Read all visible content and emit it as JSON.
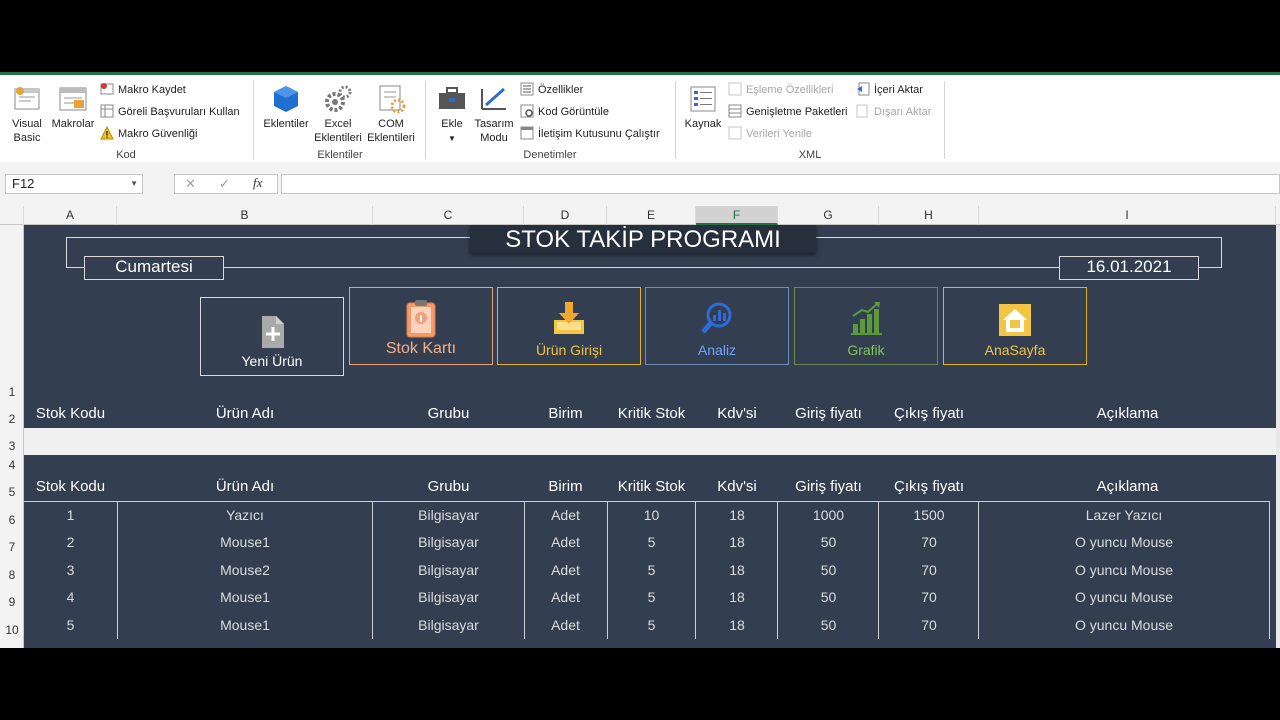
{
  "ribbon": {
    "kod": {
      "label": "Kod",
      "visual_basic": "Visual Basic",
      "makrolar": "Makrolar",
      "makro_kaydet": "Makro Kaydet",
      "goreli": "Göreli Başvuruları Kullan",
      "makro_guvenligi": "Makro Güvenliği"
    },
    "eklentiler": {
      "label": "Eklentiler",
      "eklentiler": "Eklentiler",
      "excel_eklentileri": "Excel Eklentileri",
      "com_eklentileri": "COM Eklentileri"
    },
    "denetimler": {
      "label": "Denetimler",
      "ekle": "Ekle",
      "tasarim": "Tasarım Modu",
      "ozellikler": "Özellikler",
      "kod_goruntule": "Kod Görüntüle",
      "iletisim": "İletişim Kutusunu Çalıştır"
    },
    "xml": {
      "label": "XML",
      "kaynak": "Kaynak",
      "esleme": "Eşleme Özellikleri",
      "genisletme": "Genişletme Paketleri",
      "verileri_yenile": "Verileri Yenile",
      "iceri_aktar": "İçeri Aktar",
      "disari_aktar": "Dışarı Aktar"
    }
  },
  "formula_bar": {
    "name_box": "F12",
    "cancel": "✕",
    "enter": "✓",
    "fx": "fx",
    "formula": ""
  },
  "columns": [
    "A",
    "B",
    "C",
    "D",
    "E",
    "F",
    "G",
    "H",
    "I"
  ],
  "rows": [
    "1",
    "2",
    "3",
    "4",
    "5",
    "6",
    "7",
    "8",
    "9",
    "10"
  ],
  "sheet": {
    "title": "STOK TAKİP PROGRAMI",
    "day": "Cumartesi",
    "date": "16.01.2021",
    "buttons": {
      "yeni_urun": "Yeni Ürün",
      "stok_karti": "Stok Kartı",
      "urun_girisi": "Ürün Girişi",
      "analiz": "Analiz",
      "grafik": "Grafik",
      "anasayfa": "AnaSayfa"
    },
    "headers": [
      "Stok Kodu",
      "Ürün Adı",
      "Grubu",
      "Birim",
      "Kritik Stok",
      "Kdv'si",
      "Giriş fiyatı",
      "Çıkış fiyatı",
      "Açıklama"
    ],
    "table": [
      [
        "1",
        "Yazıcı",
        "Bilgisayar",
        "Adet",
        "10",
        "18",
        "1000",
        "1500",
        "Lazer Yazıcı"
      ],
      [
        "2",
        "Mouse1",
        "Bilgisayar",
        "Adet",
        "5",
        "18",
        "50",
        "70",
        "O yuncu Mouse"
      ],
      [
        "3",
        "Mouse2",
        "Bilgisayar",
        "Adet",
        "5",
        "18",
        "50",
        "70",
        "O yuncu Mouse"
      ],
      [
        "4",
        "Mouse1",
        "Bilgisayar",
        "Adet",
        "5",
        "18",
        "50",
        "70",
        "O yuncu Mouse"
      ],
      [
        "5",
        "Mouse1",
        "Bilgisayar",
        "Adet",
        "5",
        "18",
        "50",
        "70",
        "O yuncu Mouse"
      ]
    ]
  },
  "colors": {
    "sheet_bg": "#333f50",
    "ribbon_accent": "#217346",
    "gold": "#e0b22a",
    "green": "#5a9a3a",
    "blue": "#2f6bd8"
  }
}
